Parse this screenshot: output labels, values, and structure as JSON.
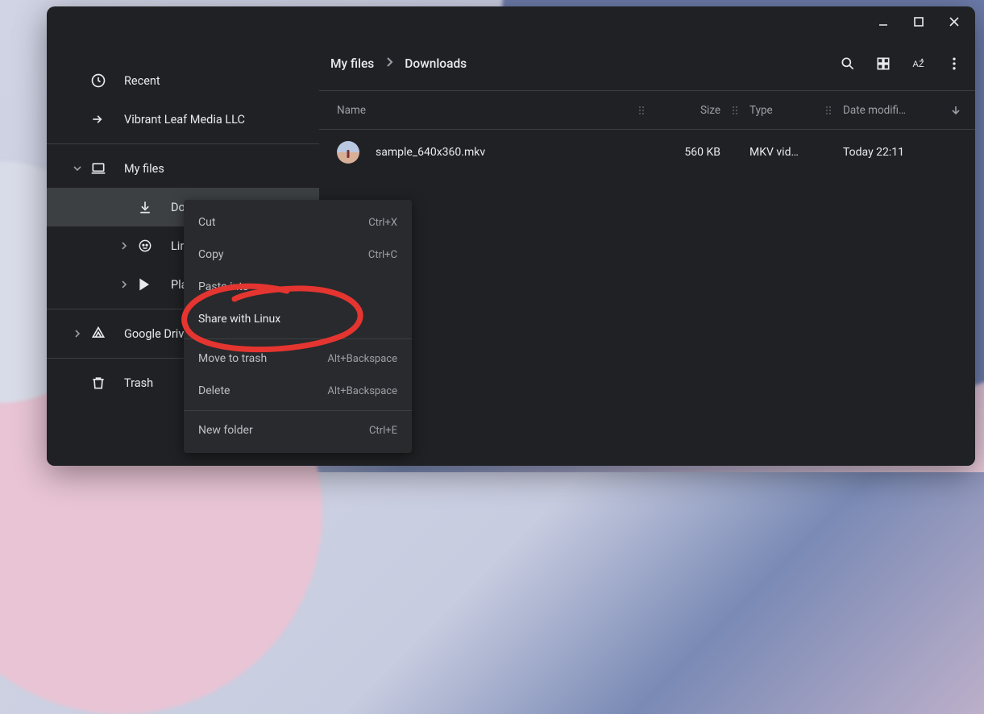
{
  "window_controls": {
    "minimize": "minimize",
    "maximize": "maximize",
    "close": "close"
  },
  "sidebar": {
    "recent": "Recent",
    "org": "Vibrant Leaf Media LLC",
    "my_files": "My files",
    "downloads": "Downloads",
    "linux_files": "Linux files",
    "play_files": "Play files",
    "google_drive": "Google Drive",
    "trash": "Trash"
  },
  "breadcrumb": {
    "root": "My files",
    "current": "Downloads"
  },
  "columns": {
    "name": "Name",
    "size": "Size",
    "type": "Type",
    "date": "Date modifi…"
  },
  "files": [
    {
      "name": "sample_640x360.mkv",
      "size": "560 KB",
      "type": "MKV vid…",
      "date": "Today 22:11"
    }
  ],
  "context_menu": {
    "cut": {
      "label": "Cut",
      "shortcut": "Ctrl+X"
    },
    "copy": {
      "label": "Copy",
      "shortcut": "Ctrl+C"
    },
    "paste_into": {
      "label": "Paste into",
      "shortcut": ""
    },
    "share_linux": {
      "label": "Share with Linux",
      "shortcut": ""
    },
    "move_trash": {
      "label": "Move to trash",
      "shortcut": "Alt+Backspace"
    },
    "delete": {
      "label": "Delete",
      "shortcut": "Alt+Backspace"
    },
    "new_folder": {
      "label": "New folder",
      "shortcut": "Ctrl+E"
    }
  }
}
